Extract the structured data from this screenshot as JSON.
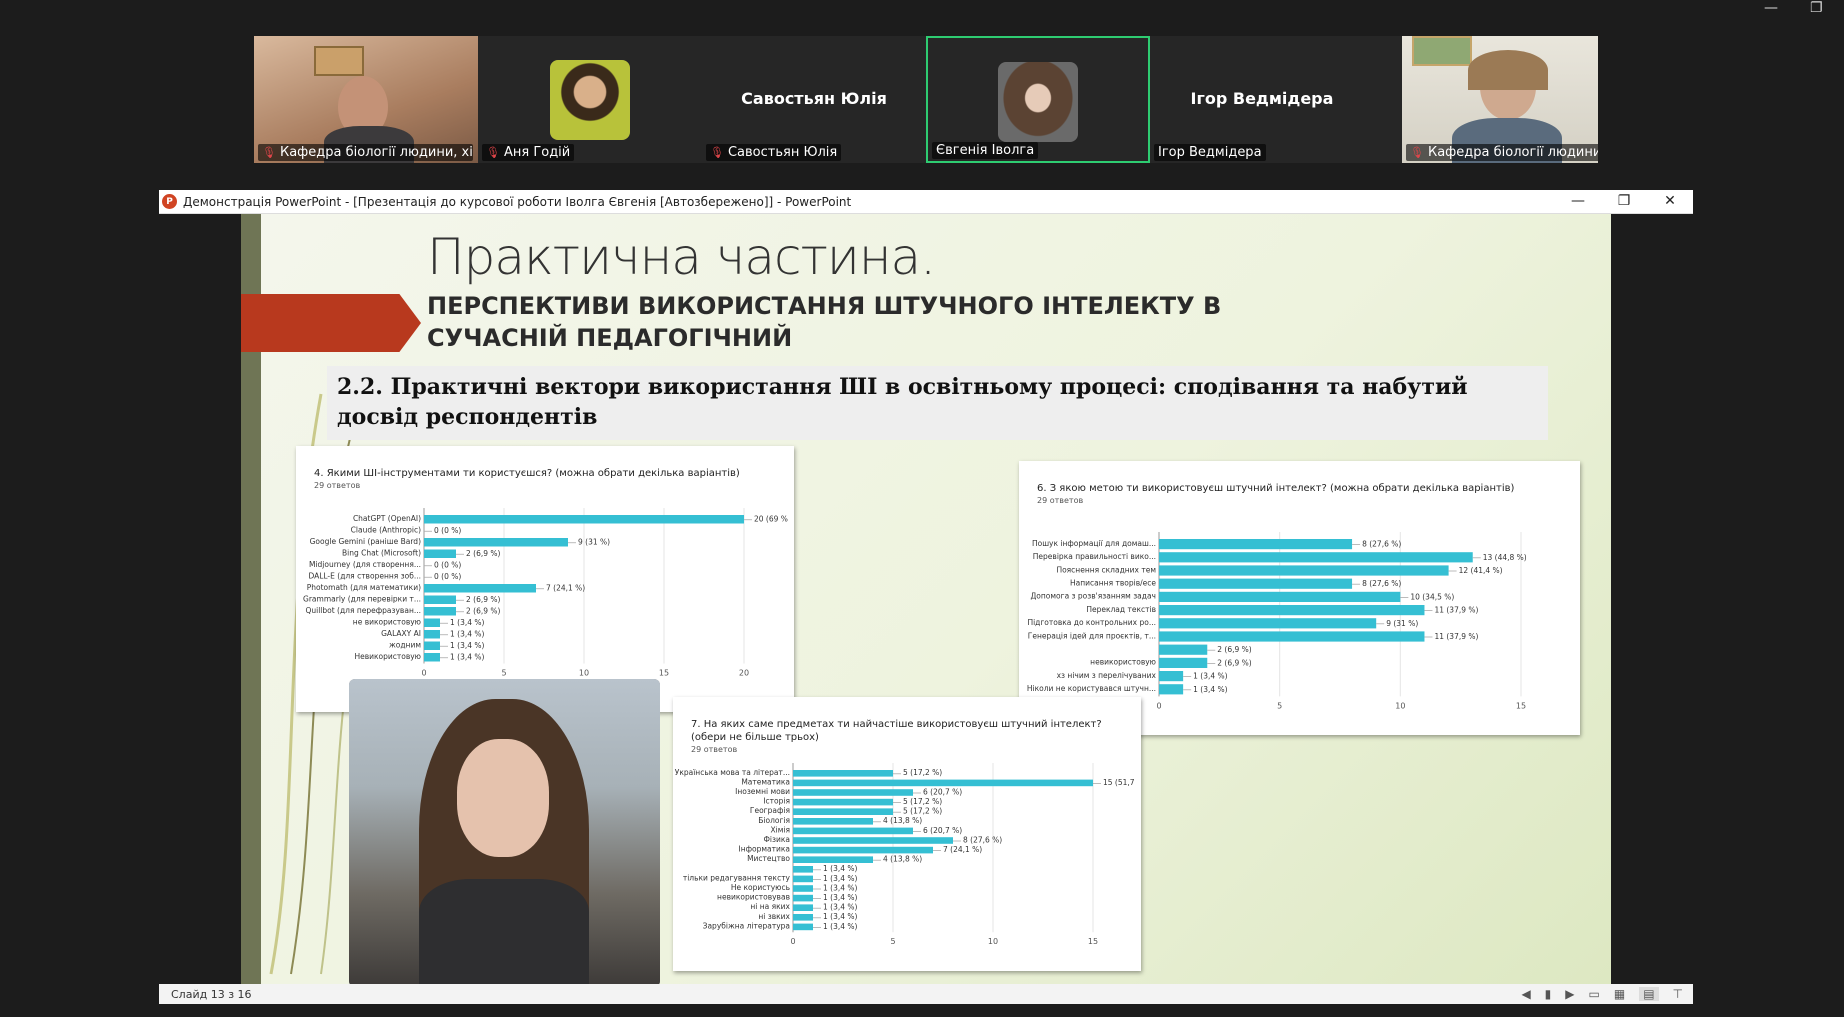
{
  "meeting": {
    "participants": [
      {
        "name": "Кафедра біології людини, хімії ...",
        "muted": true,
        "video": true
      },
      {
        "name": "Аня Годій",
        "muted": true,
        "video": false
      },
      {
        "name": "Савостьян Юлія",
        "muted": true,
        "video": false,
        "center_label": "Савостьян Юлія"
      },
      {
        "name": "Євгенія Іволга",
        "muted": false,
        "video": false,
        "active": true
      },
      {
        "name": "Ігор Ведмідера",
        "muted": false,
        "video": false,
        "center_label": "Ігор Ведмідера"
      },
      {
        "name": "Кафедра біології людини, хімії ...",
        "muted": true,
        "video": true
      }
    ]
  },
  "ppt": {
    "window_title": "Демонстрація PowerPoint - [Презентація до курсової роботи Іволга Євгенія [Автозбережено]] - PowerPoint",
    "status": "Слайд 13 з 16"
  },
  "slide": {
    "title": "Практична частина.",
    "subtitle": "ПЕРСПЕКТИВИ ВИКОРИСТАННЯ ШТУЧНОГО ІНТЕЛЕКТУ В СУЧАСНІЙ ПЕДАГОГІЧНИЙ",
    "heading": "2.2. Практичні вектори використання ШІ в освітньому процесі: сподівання та набутий досвід респондентів"
  },
  "chart_data": [
    {
      "type": "bar",
      "title": "4. Якими ШІ-інструментами ти користуєшся? (можна обрати декілька варіантів)",
      "subtitle": "29 ответов",
      "categories": [
        "ChatGPT (OpenAI)",
        "Claude (Anthropic)",
        "Google Gemini (раніше Bard)",
        "Bing Chat (Microsoft)",
        "Midjourney (для створення...",
        "DALL-E (для створення зоб...",
        "Photomath (для математики)",
        "Grammarly (для перевірки т...",
        "Quillbot (для перефразуван...",
        "не використовую",
        "GALAXY AI",
        "жодним",
        "Невикористовую"
      ],
      "values": [
        20,
        0,
        9,
        2,
        0,
        0,
        7,
        2,
        2,
        1,
        1,
        1,
        1
      ],
      "labels": [
        "20 (69 %",
        "0 (0 %)",
        "9 (31 %)",
        "2 (6,9 %)",
        "0 (0 %)",
        "0 (0 %)",
        "7 (24,1 %)",
        "2 (6,9 %)",
        "2 (6,9 %)",
        "1 (3,4 %)",
        "1 (3,4 %)",
        "1 (3,4 %)",
        "1 (3,4 %)"
      ],
      "xticks": [
        "0",
        "5",
        "10",
        "15",
        "20"
      ],
      "xlim": [
        0,
        20
      ]
    },
    {
      "type": "bar",
      "title": "6. З якою метою ти використовуєш штучний інтелект? (можна обрати декілька варіантів)",
      "subtitle": "29 ответов",
      "categories": [
        "Пошук інформації для домаш...",
        "Перевірка правильності вико...",
        "Пояснення складних тем",
        "Написання творів/есе",
        "Допомога з розв'язанням задач",
        "Переклад текстів",
        "Підготовка до контрольних ро...",
        "Генерація ідей для проєктів, т...",
        "",
        "невикористовую",
        "хз нічим з перелічуваних",
        "Ніколи не користувався штучн..."
      ],
      "values": [
        8,
        13,
        12,
        8,
        10,
        11,
        9,
        11,
        2,
        2,
        1,
        1
      ],
      "labels": [
        "8 (27,6 %)",
        "13 (44,8 %)",
        "12 (41,4 %)",
        "8 (27,6 %)",
        "10 (34,5 %)",
        "11 (37,9 %)",
        "9 (31 %)",
        "11 (37,9 %)",
        "2 (6,9 %)",
        "2 (6,9 %)",
        "1 (3,4 %)",
        "1 (3,4 %)"
      ],
      "xticks": [
        "0",
        "5",
        "10",
        "15"
      ],
      "xlim": [
        0,
        15
      ]
    },
    {
      "type": "bar",
      "title": "7. На яких саме предметах ти найчастіше використовуєш штучний інтелект? (обери не більше трьох)",
      "subtitle": "29 ответов",
      "categories": [
        "Українська мова та літерат...",
        "Математика",
        "Іноземні мови",
        "Історія",
        "Географія",
        "Біологія",
        "Хімія",
        "Фізика",
        "Інформатика",
        "Мистецтво",
        "",
        "тільки редагування тексту",
        "Не користуюсь",
        "невикористовував",
        "ні на яких",
        "ні звких",
        "Зарубіжна література"
      ],
      "values": [
        5,
        15,
        6,
        5,
        5,
        4,
        6,
        8,
        7,
        4,
        1,
        1,
        1,
        1,
        1,
        1,
        1
      ],
      "labels": [
        "5 (17,2 %)",
        "15 (51,7",
        "6 (20,7 %)",
        "5 (17,2 %)",
        "5 (17,2 %)",
        "4 (13,8 %)",
        "6 (20,7 %)",
        "8 (27,6 %)",
        "7 (24,1 %)",
        "4 (13,8 %)",
        "1 (3,4 %)",
        "1 (3,4 %)",
        "1 (3,4 %)",
        "1 (3,4 %)",
        "1 (3,4 %)",
        "1 (3,4 %)",
        "1 (3,4 %)"
      ],
      "xticks": [
        "0",
        "5",
        "10",
        "15"
      ],
      "xlim": [
        0,
        15
      ]
    }
  ],
  "colors": {
    "bar": "#35bfd3",
    "accent_red": "#b8391e",
    "active_tile": "#2ecc71"
  }
}
